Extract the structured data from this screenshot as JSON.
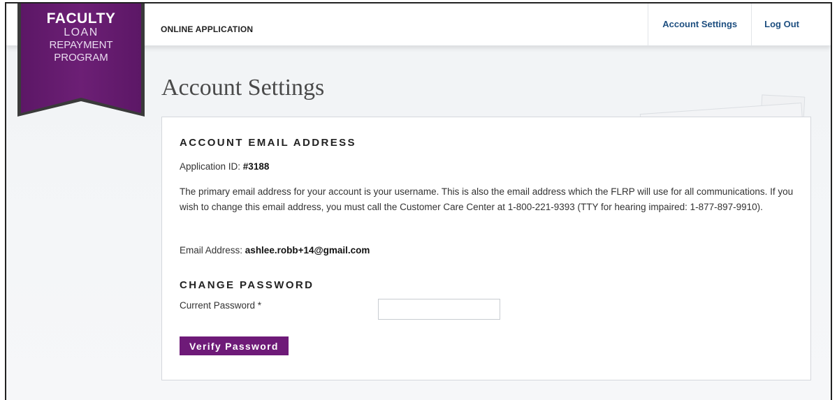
{
  "logo": {
    "line1": "FACULTY",
    "line2": "LOAN",
    "line3": "REPAYMENT",
    "line4": "PROGRAM",
    "ribbon_color": "#6a1d72"
  },
  "header": {
    "section_title": "ONLINE APPLICATION",
    "nav": {
      "account_settings": "Account Settings",
      "log_out": "Log Out"
    },
    "link_color": "#1e4f80"
  },
  "page": {
    "title": "Account Settings"
  },
  "account_email": {
    "heading": "ACCOUNT EMAIL ADDRESS",
    "app_id_label": "Application ID: ",
    "app_id_value": "#3188",
    "description": "The primary email address for your account is your username. This is also the email address which the FLRP will use for all communications. If you wish to change this email address, you must call the Customer Care Center at 1-800-221-9393 (TTY for hearing impaired: 1-877-897-9910).",
    "email_label": "Email Address: ",
    "email_value": "ashlee.robb+14@gmail.com"
  },
  "change_password": {
    "heading": "CHANGE PASSWORD",
    "current_label": "Current Password *",
    "current_value": "",
    "verify_button": "Verify Password",
    "button_color": "#6e1a78"
  }
}
